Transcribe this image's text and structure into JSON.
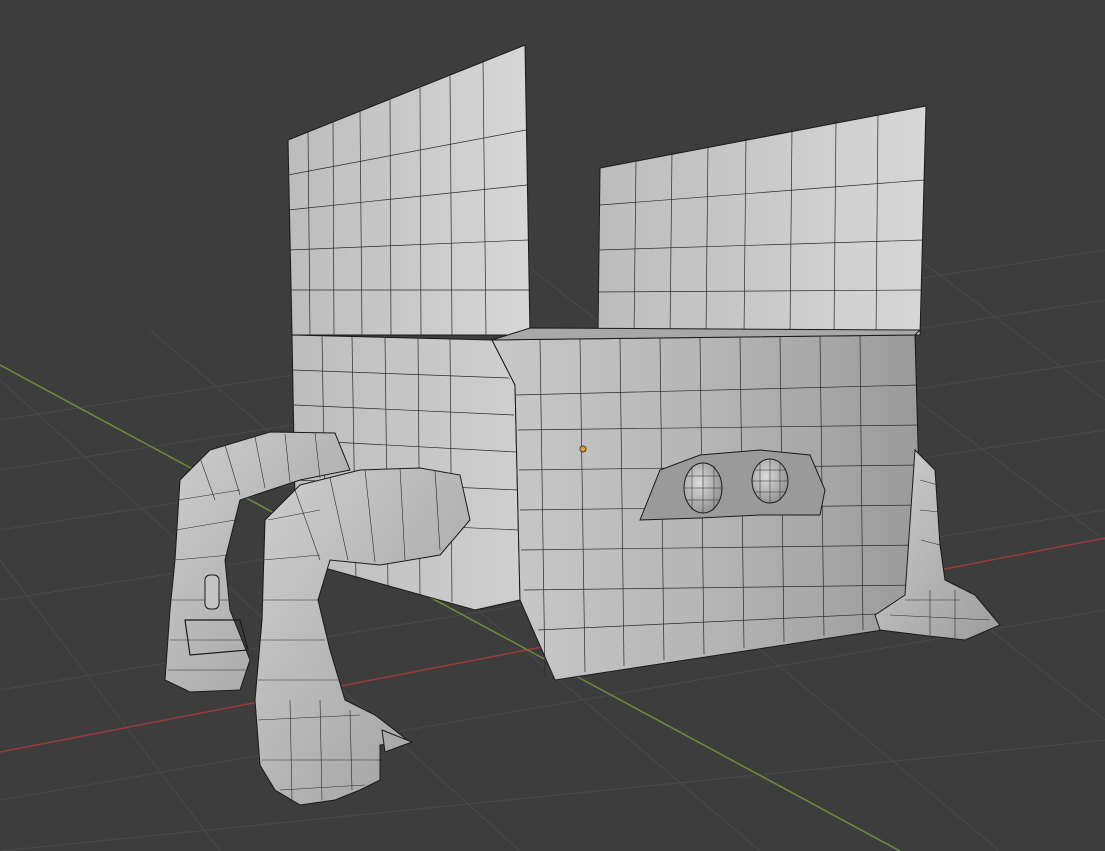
{
  "viewport": {
    "mode": "solid-shading-wireframe-overlay",
    "background": "#3d3d3d",
    "grid_color": "#4a4a4a",
    "x_axis_color": "#9b3a3a",
    "y_axis_color": "#6d8c3a",
    "origin_color": "#f09a2a"
  },
  "scene": {
    "object": {
      "shading_light": "#d6d6d6",
      "shading_mid": "#b4b4b4",
      "shading_dark": "#8e8e8e",
      "wire_color": "#1a1a1a"
    }
  }
}
